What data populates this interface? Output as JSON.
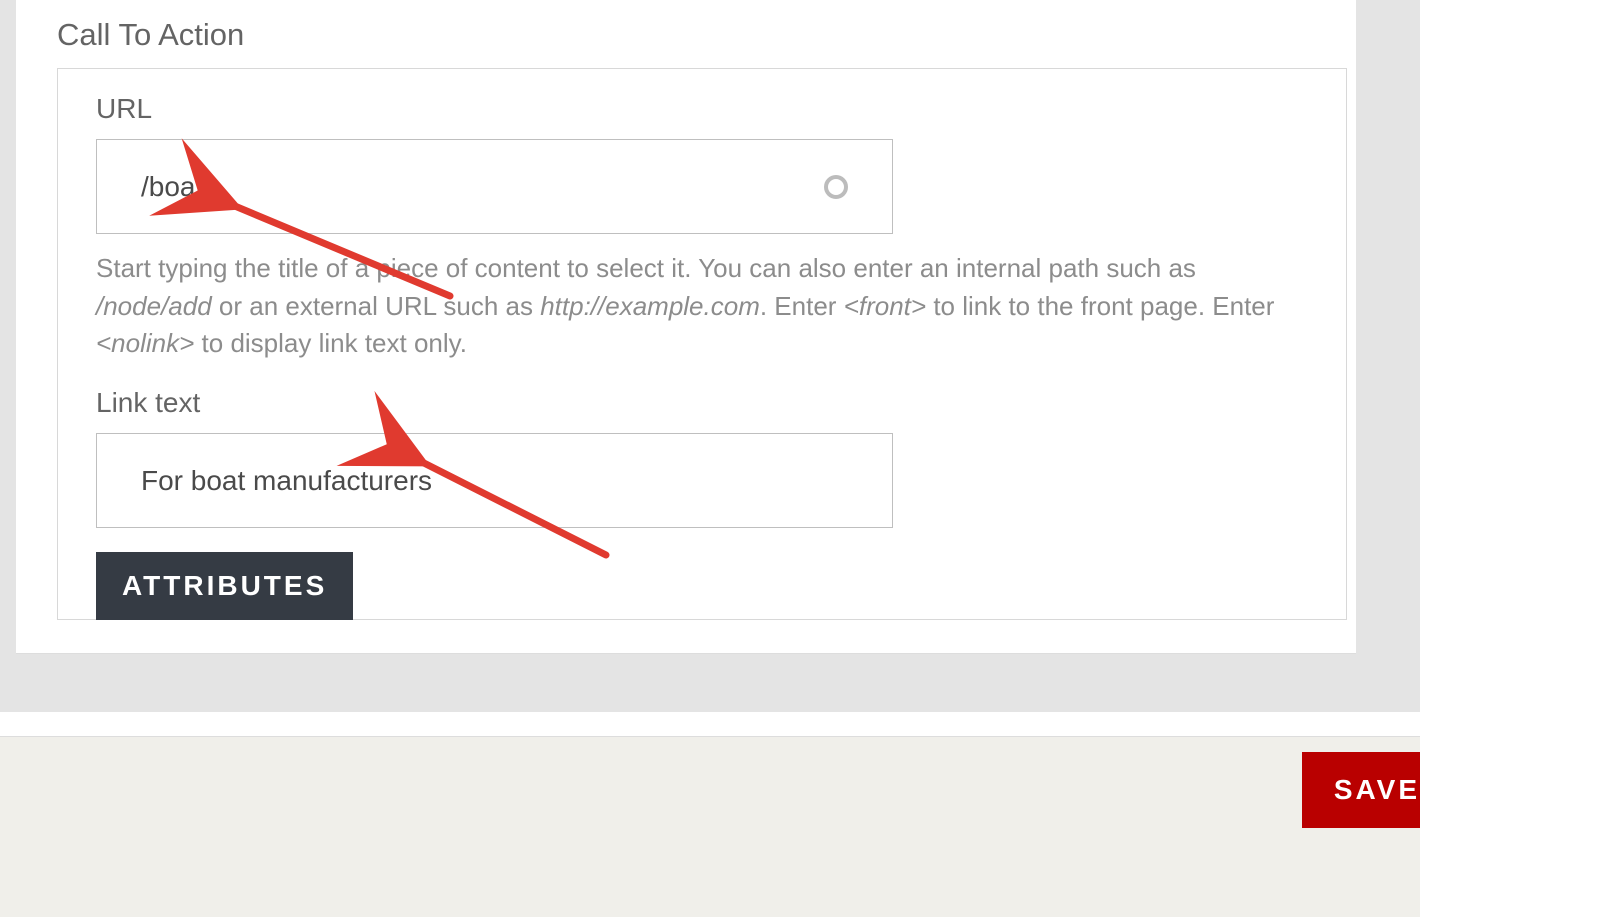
{
  "section": {
    "title": "Call To Action"
  },
  "url": {
    "label": "URL",
    "value": "/boats",
    "help_pre": "Start typing the title of a piece of content to select it. You can also enter an internal path such as ",
    "help_italic1": "/node/add",
    "help_mid1": " or an external URL such as ",
    "help_italic2": "http://example.com",
    "help_mid2": ". Enter ",
    "help_italic3": "<front>",
    "help_mid3": " to link to the front page. Enter ",
    "help_italic4": "<nolink>",
    "help_post": " to display link text only."
  },
  "linktext": {
    "label": "Link text",
    "value": "For boat manufacturers"
  },
  "buttons": {
    "attributes": "ATTRIBUTES",
    "save": "SAVE"
  }
}
